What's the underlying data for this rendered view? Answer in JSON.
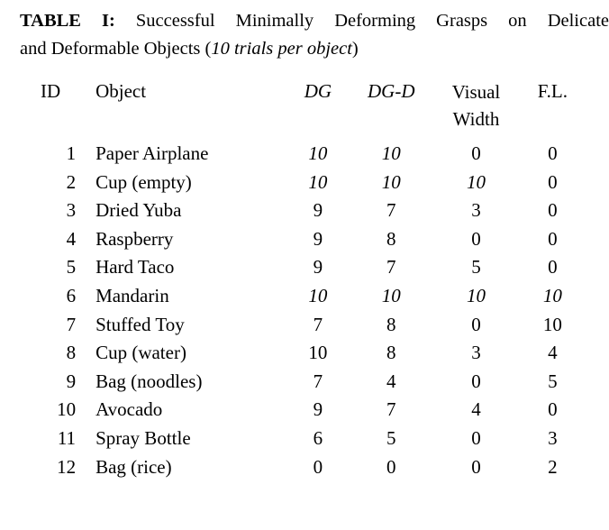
{
  "caption": {
    "label": "TABLE I:",
    "line1": "Successful Minimally Deforming Grasps on Delicate",
    "line2_pre": "and Deformable Objects (",
    "line2_italic": "10 trials per object",
    "line2_post": ")"
  },
  "table": {
    "headers": {
      "id": "ID",
      "object": "Object",
      "dg": "DG",
      "dgd": "DG-D",
      "visual_width_line1": "Visual",
      "visual_width_line2": "Width",
      "fl": "F.L."
    },
    "columns": [
      "ID",
      "Object",
      "DG",
      "DG-D",
      "Visual Width",
      "F.L."
    ],
    "rows": [
      {
        "id": "1",
        "object": "Paper Airplane",
        "dg": "10",
        "dg_style": "bold-italic",
        "dgd": "10",
        "dgd_style": "bold-italic",
        "vw": "0",
        "vw_style": "plain",
        "fl": "0",
        "fl_style": "plain"
      },
      {
        "id": "2",
        "object": "Cup (empty)",
        "dg": "10",
        "dg_style": "bold-italic",
        "dgd": "10",
        "dgd_style": "bold-italic",
        "vw": "10",
        "vw_style": "bold-italic",
        "fl": "0",
        "fl_style": "plain"
      },
      {
        "id": "3",
        "object": "Dried Yuba",
        "dg": "9",
        "dg_style": "bold",
        "dgd": "7",
        "dgd_style": "plain",
        "vw": "3",
        "vw_style": "plain",
        "fl": "0",
        "fl_style": "plain"
      },
      {
        "id": "4",
        "object": "Raspberry",
        "dg": "9",
        "dg_style": "bold",
        "dgd": "8",
        "dgd_style": "plain",
        "vw": "0",
        "vw_style": "plain",
        "fl": "0",
        "fl_style": "plain"
      },
      {
        "id": "5",
        "object": "Hard Taco",
        "dg": "9",
        "dg_style": "bold",
        "dgd": "7",
        "dgd_style": "plain",
        "vw": "5",
        "vw_style": "plain",
        "fl": "0",
        "fl_style": "plain"
      },
      {
        "id": "6",
        "object": "Mandarin",
        "dg": "10",
        "dg_style": "bold-italic",
        "dgd": "10",
        "dgd_style": "bold-italic",
        "vw": "10",
        "vw_style": "bold-italic",
        "fl": "10",
        "fl_style": "bold-italic"
      },
      {
        "id": "7",
        "object": "Stuffed Toy",
        "dg": "7",
        "dg_style": "plain",
        "dgd": "8",
        "dgd_style": "plain",
        "vw": "0",
        "vw_style": "plain",
        "fl": "10",
        "fl_style": "bold"
      },
      {
        "id": "8",
        "object": "Cup (water)",
        "dg": "10",
        "dg_style": "bold",
        "dgd": "8",
        "dgd_style": "plain",
        "vw": "3",
        "vw_style": "plain",
        "fl": "4",
        "fl_style": "plain"
      },
      {
        "id": "9",
        "object": "Bag (noodles)",
        "dg": "7",
        "dg_style": "bold",
        "dgd": "4",
        "dgd_style": "plain",
        "vw": "0",
        "vw_style": "plain",
        "fl": "5",
        "fl_style": "plain"
      },
      {
        "id": "10",
        "object": "Avocado",
        "dg": "9",
        "dg_style": "bold",
        "dgd": "7",
        "dgd_style": "plain",
        "vw": "4",
        "vw_style": "plain",
        "fl": "0",
        "fl_style": "plain"
      },
      {
        "id": "11",
        "object": "Spray Bottle",
        "dg": "6",
        "dg_style": "bold",
        "dgd": "5",
        "dgd_style": "plain",
        "vw": "0",
        "vw_style": "plain",
        "fl": "3",
        "fl_style": "plain"
      },
      {
        "id": "12",
        "object": "Bag (rice)",
        "dg": "0",
        "dg_style": "plain",
        "dgd": "0",
        "dgd_style": "plain",
        "vw": "0",
        "vw_style": "plain",
        "fl": "2",
        "fl_style": "bold"
      }
    ]
  }
}
